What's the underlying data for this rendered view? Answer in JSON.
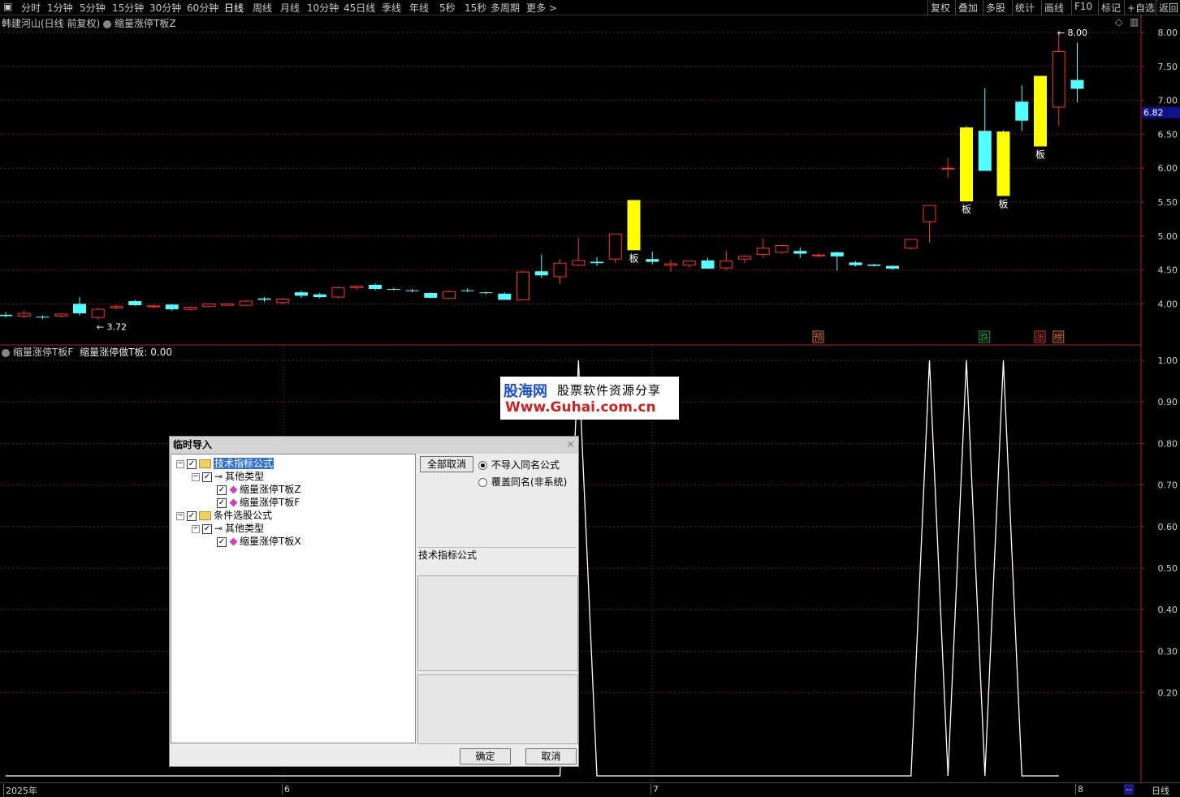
{
  "toolbar": {
    "periods": [
      "分时",
      "1分钟",
      "5分钟",
      "15分钟",
      "30分钟",
      "60分钟",
      "日线",
      "周线",
      "月线",
      "10分钟",
      "45日线",
      "季线",
      "年线",
      "5秒",
      "15秒",
      "多周期",
      "更多 >"
    ],
    "active_period": "日线",
    "right_tools": [
      "复权",
      "叠加",
      "多股",
      "统计",
      "画线",
      "F10",
      "标记",
      "+自选",
      "返回"
    ]
  },
  "header": {
    "stock_title": "韩建河山(日线 前复权)",
    "indicator_name": "缩量涨停T板Z"
  },
  "price_panel": {
    "current_price": "6.82",
    "high_label": "8.00",
    "low_label": "3.72",
    "axis_ticks": [
      "8.00",
      "7.50",
      "7.00",
      "6.50",
      "6.00",
      "5.50",
      "5.00",
      "4.50",
      "4.00"
    ],
    "board_marks": [
      "板",
      "板",
      "板",
      "板"
    ],
    "tags": [
      {
        "text": "预",
        "color": "#e07020"
      },
      {
        "text": "跌",
        "color": "#20a040"
      },
      {
        "text": "涨",
        "color": "#e03030"
      },
      {
        "text": "榜",
        "color": "#e07020"
      }
    ],
    "colors": {
      "up": "#ff3030",
      "down": "#54ffff",
      "board": "#ffff00"
    }
  },
  "indicator_panel": {
    "title": "缩量涨停T板F",
    "value_label": "缩量涨停做T板: 0.00",
    "axis_ticks": [
      "1.00",
      "0.90",
      "0.80",
      "0.70",
      "0.60",
      "0.50",
      "0.40",
      "0.30",
      "0.20"
    ],
    "spike_bars": [
      31,
      50,
      52,
      54
    ],
    "bar_count": 58
  },
  "x_axis": {
    "labels": [
      "2025年",
      "6",
      "7",
      "8"
    ],
    "period": "日线",
    "dash": "--"
  },
  "watermark": {
    "brand": "股海网",
    "slogan": "股票软件资源分享",
    "url": "Www.Guhai.com.cn"
  },
  "dialog": {
    "title": "临时导入",
    "close": "✕",
    "tree": [
      {
        "label": "技术指标公式",
        "level": 0,
        "type": "folder",
        "selected": true
      },
      {
        "label": "其他类型",
        "level": 1,
        "type": "key"
      },
      {
        "label": "缩量涨停T板Z",
        "level": 2,
        "type": "item"
      },
      {
        "label": "缩量涨停T板F",
        "level": 2,
        "type": "item"
      },
      {
        "label": "条件选股公式",
        "level": 0,
        "type": "folder"
      },
      {
        "label": "其他类型",
        "level": 1,
        "type": "key"
      },
      {
        "label": "缩量涨停T板X",
        "level": 2,
        "type": "item"
      }
    ],
    "cancel_all": "全部取消",
    "radio_no_import": "不导入同名公式",
    "radio_overwrite": "覆盖同名(非系统)",
    "section_label": "技术指标公式",
    "ok": "确定",
    "cancel": "取消"
  },
  "chart_data": {
    "type": "candlestick",
    "title": "韩建河山(日线 前复权)",
    "ylim": [
      3.6,
      8.1
    ],
    "candles": [
      {
        "o": 3.84,
        "h": 3.88,
        "l": 3.8,
        "c": 3.82
      },
      {
        "o": 3.82,
        "h": 3.9,
        "l": 3.79,
        "c": 3.86
      },
      {
        "o": 3.81,
        "h": 3.83,
        "l": 3.78,
        "c": 3.8
      },
      {
        "o": 3.82,
        "h": 3.86,
        "l": 3.8,
        "c": 3.85
      },
      {
        "o": 4.0,
        "h": 4.1,
        "l": 3.83,
        "c": 3.86
      },
      {
        "o": 3.8,
        "h": 3.94,
        "l": 3.76,
        "c": 3.92
      },
      {
        "o": 3.94,
        "h": 3.98,
        "l": 3.92,
        "c": 3.96
      },
      {
        "o": 4.04,
        "h": 4.06,
        "l": 3.97,
        "c": 3.98
      },
      {
        "o": 3.96,
        "h": 3.99,
        "l": 3.93,
        "c": 3.97
      },
      {
        "o": 3.99,
        "h": 4.0,
        "l": 3.9,
        "c": 3.92
      },
      {
        "o": 3.92,
        "h": 3.96,
        "l": 3.9,
        "c": 3.95
      },
      {
        "o": 3.96,
        "h": 4.01,
        "l": 3.95,
        "c": 4.0
      },
      {
        "o": 3.98,
        "h": 4.01,
        "l": 3.97,
        "c": 4.0
      },
      {
        "o": 3.98,
        "h": 4.06,
        "l": 3.97,
        "c": 4.04
      },
      {
        "o": 4.08,
        "h": 4.1,
        "l": 4.03,
        "c": 4.06
      },
      {
        "o": 4.02,
        "h": 4.09,
        "l": 3.99,
        "c": 4.07
      },
      {
        "o": 4.17,
        "h": 4.19,
        "l": 4.09,
        "c": 4.12
      },
      {
        "o": 4.14,
        "h": 4.16,
        "l": 4.08,
        "c": 4.1
      },
      {
        "o": 4.1,
        "h": 4.26,
        "l": 4.08,
        "c": 4.24
      },
      {
        "o": 4.24,
        "h": 4.27,
        "l": 4.21,
        "c": 4.26
      },
      {
        "o": 4.28,
        "h": 4.3,
        "l": 4.2,
        "c": 4.22
      },
      {
        "o": 4.22,
        "h": 4.24,
        "l": 4.2,
        "c": 4.21
      },
      {
        "o": 4.2,
        "h": 4.22,
        "l": 4.17,
        "c": 4.19
      },
      {
        "o": 4.16,
        "h": 4.17,
        "l": 4.08,
        "c": 4.09
      },
      {
        "o": 4.08,
        "h": 4.2,
        "l": 4.07,
        "c": 4.18
      },
      {
        "o": 4.2,
        "h": 4.23,
        "l": 4.17,
        "c": 4.19
      },
      {
        "o": 4.17,
        "h": 4.18,
        "l": 4.14,
        "c": 4.16
      },
      {
        "o": 4.15,
        "h": 4.17,
        "l": 4.06,
        "c": 4.06
      },
      {
        "o": 4.06,
        "h": 4.48,
        "l": 4.05,
        "c": 4.47
      },
      {
        "o": 4.48,
        "h": 4.73,
        "l": 4.38,
        "c": 4.42
      },
      {
        "o": 4.4,
        "h": 4.66,
        "l": 4.29,
        "c": 4.6
      },
      {
        "o": 4.57,
        "h": 4.98,
        "l": 4.55,
        "c": 4.64
      },
      {
        "o": 4.62,
        "h": 4.69,
        "l": 4.56,
        "c": 4.6
      },
      {
        "o": 4.66,
        "h": 5.03,
        "l": 4.6,
        "c": 5.03
      },
      {
        "o": 5.53,
        "h": 5.53,
        "l": 4.79,
        "c": 4.79
      },
      {
        "o": 4.66,
        "h": 4.77,
        "l": 4.58,
        "c": 4.62
      },
      {
        "o": 4.57,
        "h": 4.65,
        "l": 4.47,
        "c": 4.59
      },
      {
        "o": 4.57,
        "h": 4.64,
        "l": 4.53,
        "c": 4.63
      },
      {
        "o": 4.64,
        "h": 4.68,
        "l": 4.52,
        "c": 4.52
      },
      {
        "o": 4.53,
        "h": 4.78,
        "l": 4.5,
        "c": 4.63
      },
      {
        "o": 4.66,
        "h": 4.72,
        "l": 4.6,
        "c": 4.7
      },
      {
        "o": 4.73,
        "h": 4.97,
        "l": 4.68,
        "c": 4.82
      },
      {
        "o": 4.76,
        "h": 4.87,
        "l": 4.74,
        "c": 4.86
      },
      {
        "o": 4.78,
        "h": 4.83,
        "l": 4.68,
        "c": 4.74
      },
      {
        "o": 4.72,
        "h": 4.75,
        "l": 4.69,
        "c": 4.72
      },
      {
        "o": 4.76,
        "h": 4.77,
        "l": 4.49,
        "c": 4.7
      },
      {
        "o": 4.61,
        "h": 4.63,
        "l": 4.55,
        "c": 4.57
      },
      {
        "o": 4.58,
        "h": 4.59,
        "l": 4.55,
        "c": 4.56
      },
      {
        "o": 4.56,
        "h": 4.57,
        "l": 4.5,
        "c": 4.52
      },
      {
        "o": 4.82,
        "h": 4.95,
        "l": 4.8,
        "c": 4.95
      },
      {
        "o": 5.21,
        "h": 5.45,
        "l": 4.9,
        "c": 5.45
      },
      {
        "o": 5.99,
        "h": 6.15,
        "l": 5.86,
        "c": 6.0
      },
      {
        "o": 5.51,
        "h": 6.62,
        "l": 5.51,
        "c": 6.6
      },
      {
        "o": 6.55,
        "h": 7.18,
        "l": 5.96,
        "c": 5.96
      },
      {
        "o": 5.59,
        "h": 6.56,
        "l": 5.59,
        "c": 6.54
      },
      {
        "o": 6.98,
        "h": 7.22,
        "l": 6.55,
        "c": 6.7
      },
      {
        "o": 6.32,
        "h": 7.36,
        "l": 6.32,
        "c": 7.36
      },
      {
        "o": 6.9,
        "h": 8.0,
        "l": 6.62,
        "c": 7.72
      },
      {
        "o": 7.3,
        "h": 7.85,
        "l": 6.97,
        "c": 7.17
      }
    ],
    "board_candles": [
      34,
      52,
      54,
      56
    ]
  }
}
